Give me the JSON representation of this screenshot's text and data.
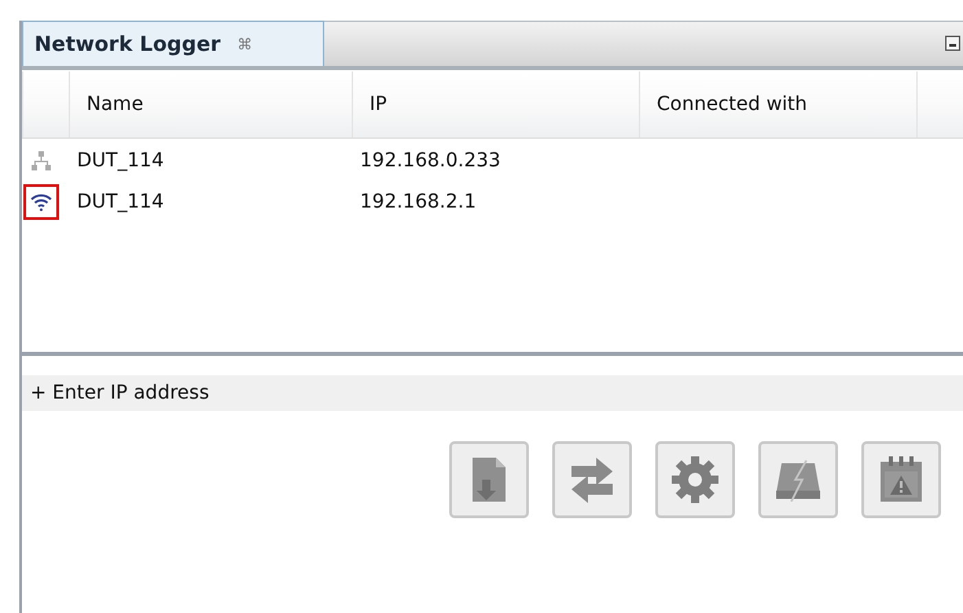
{
  "panel": {
    "title": "Network Logger",
    "close_glyph": "⌘"
  },
  "table": {
    "columns": [
      "Name",
      "IP",
      "Connected with"
    ],
    "rows": [
      {
        "kind": "wired",
        "highlighted": false,
        "cells": [
          "DUT_114",
          "192.168.0.233",
          ""
        ]
      },
      {
        "kind": "wireless",
        "highlighted": true,
        "cells": [
          "DUT_114",
          "192.168.2.1",
          ""
        ]
      }
    ]
  },
  "add_row": {
    "label": "+ Enter IP address"
  },
  "buttons": [
    {
      "kind": "download",
      "disabled": true
    },
    {
      "kind": "swap",
      "disabled": true
    },
    {
      "kind": "settings",
      "disabled": true
    },
    {
      "kind": "drive",
      "disabled": true
    },
    {
      "kind": "calendar-warning",
      "disabled": true
    }
  ]
}
